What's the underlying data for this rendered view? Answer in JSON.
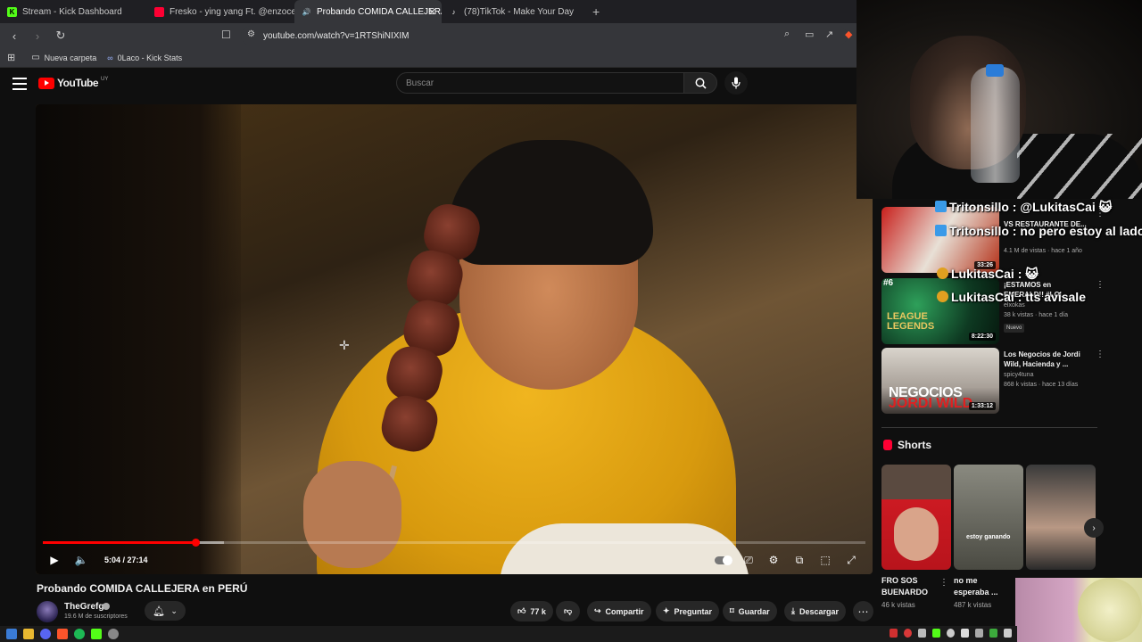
{
  "browser": {
    "tabs": [
      {
        "label": "Stream - Kick Dashboard",
        "favicon": "kick-icon",
        "color": "#53fc18",
        "active": false
      },
      {
        "label": "Fresko - ying yang Ft. @enzocerobul",
        "favicon": "youtube-icon",
        "color": "#ff0033",
        "active": false
      },
      {
        "label": "Probando COMIDA CALLEJERA",
        "favicon": "youtube-icon",
        "color": "#ff0033",
        "active": true
      },
      {
        "label": "(78)TikTok - Make Your Day",
        "favicon": "tiktok-icon",
        "color": "#ffffff",
        "active": false
      }
    ],
    "url": "youtube.com/watch?v=1RTShiNIXIM",
    "bookmarks": [
      {
        "label": "Nueva carpeta",
        "icon": "folder-icon"
      },
      {
        "label": "0Laco - Kick Stats",
        "icon": "stats-icon"
      }
    ]
  },
  "youtube": {
    "logo_text": "YouTube",
    "country_code": "UY",
    "search_placeholder": "Buscar"
  },
  "player": {
    "time": "5:04 / 27:14",
    "progress_fraction": 0.186,
    "buffer_fraction": 0.22
  },
  "video": {
    "title": "Probando COMIDA CALLEJERA en PERÚ",
    "channel": "TheGrefg",
    "subscribers": "19.6 M de suscriptores",
    "likes": "77 k",
    "actions": {
      "share": "Compartir",
      "ask": "Preguntar",
      "save": "Guardar",
      "download": "Descargar"
    }
  },
  "recommendations": [
    {
      "title": "VS RESTAURANTE DE...",
      "channel": "",
      "meta": "4.1 M de vistas · hace 1 año",
      "duration": "33:26",
      "badge": "",
      "thumb_text": ""
    },
    {
      "title": "¡ESTAMOS en EMERALD!! #LOL",
      "channel": "elxokas",
      "meta": "38 k vistas · hace 1 día",
      "duration": "8:22:30",
      "badge": "Nuevo",
      "thumb_text": "#6"
    },
    {
      "title": "Los Negocios de Jordi Wild, Hacienda y ...",
      "channel": "spicy4tuna",
      "meta": "868 k vistas · hace 13 días",
      "duration": "1:33:12",
      "badge": "",
      "thumb_text": "NEGOCIOS",
      "thumb_text2": "JORDI WILD"
    }
  ],
  "chat": [
    {
      "user": "Tritonsillo",
      "message": "@LukitasCai"
    },
    {
      "user": "Tritonsillo",
      "message": "no pero estoy al lado"
    },
    {
      "user": "LukitasCai",
      "message": ""
    },
    {
      "user": "LukitasCai",
      "message": "tts avisale"
    }
  ],
  "shorts": {
    "heading": "Shorts",
    "items": [
      {
        "title": "FRO SOS BUENARDO",
        "views": "46 k vistas",
        "overlay": ""
      },
      {
        "title": "no me esperaba ...",
        "views": "487 k vistas",
        "overlay": "estoy ganando"
      },
      {
        "title": "",
        "views": "",
        "overlay": ""
      }
    ]
  }
}
